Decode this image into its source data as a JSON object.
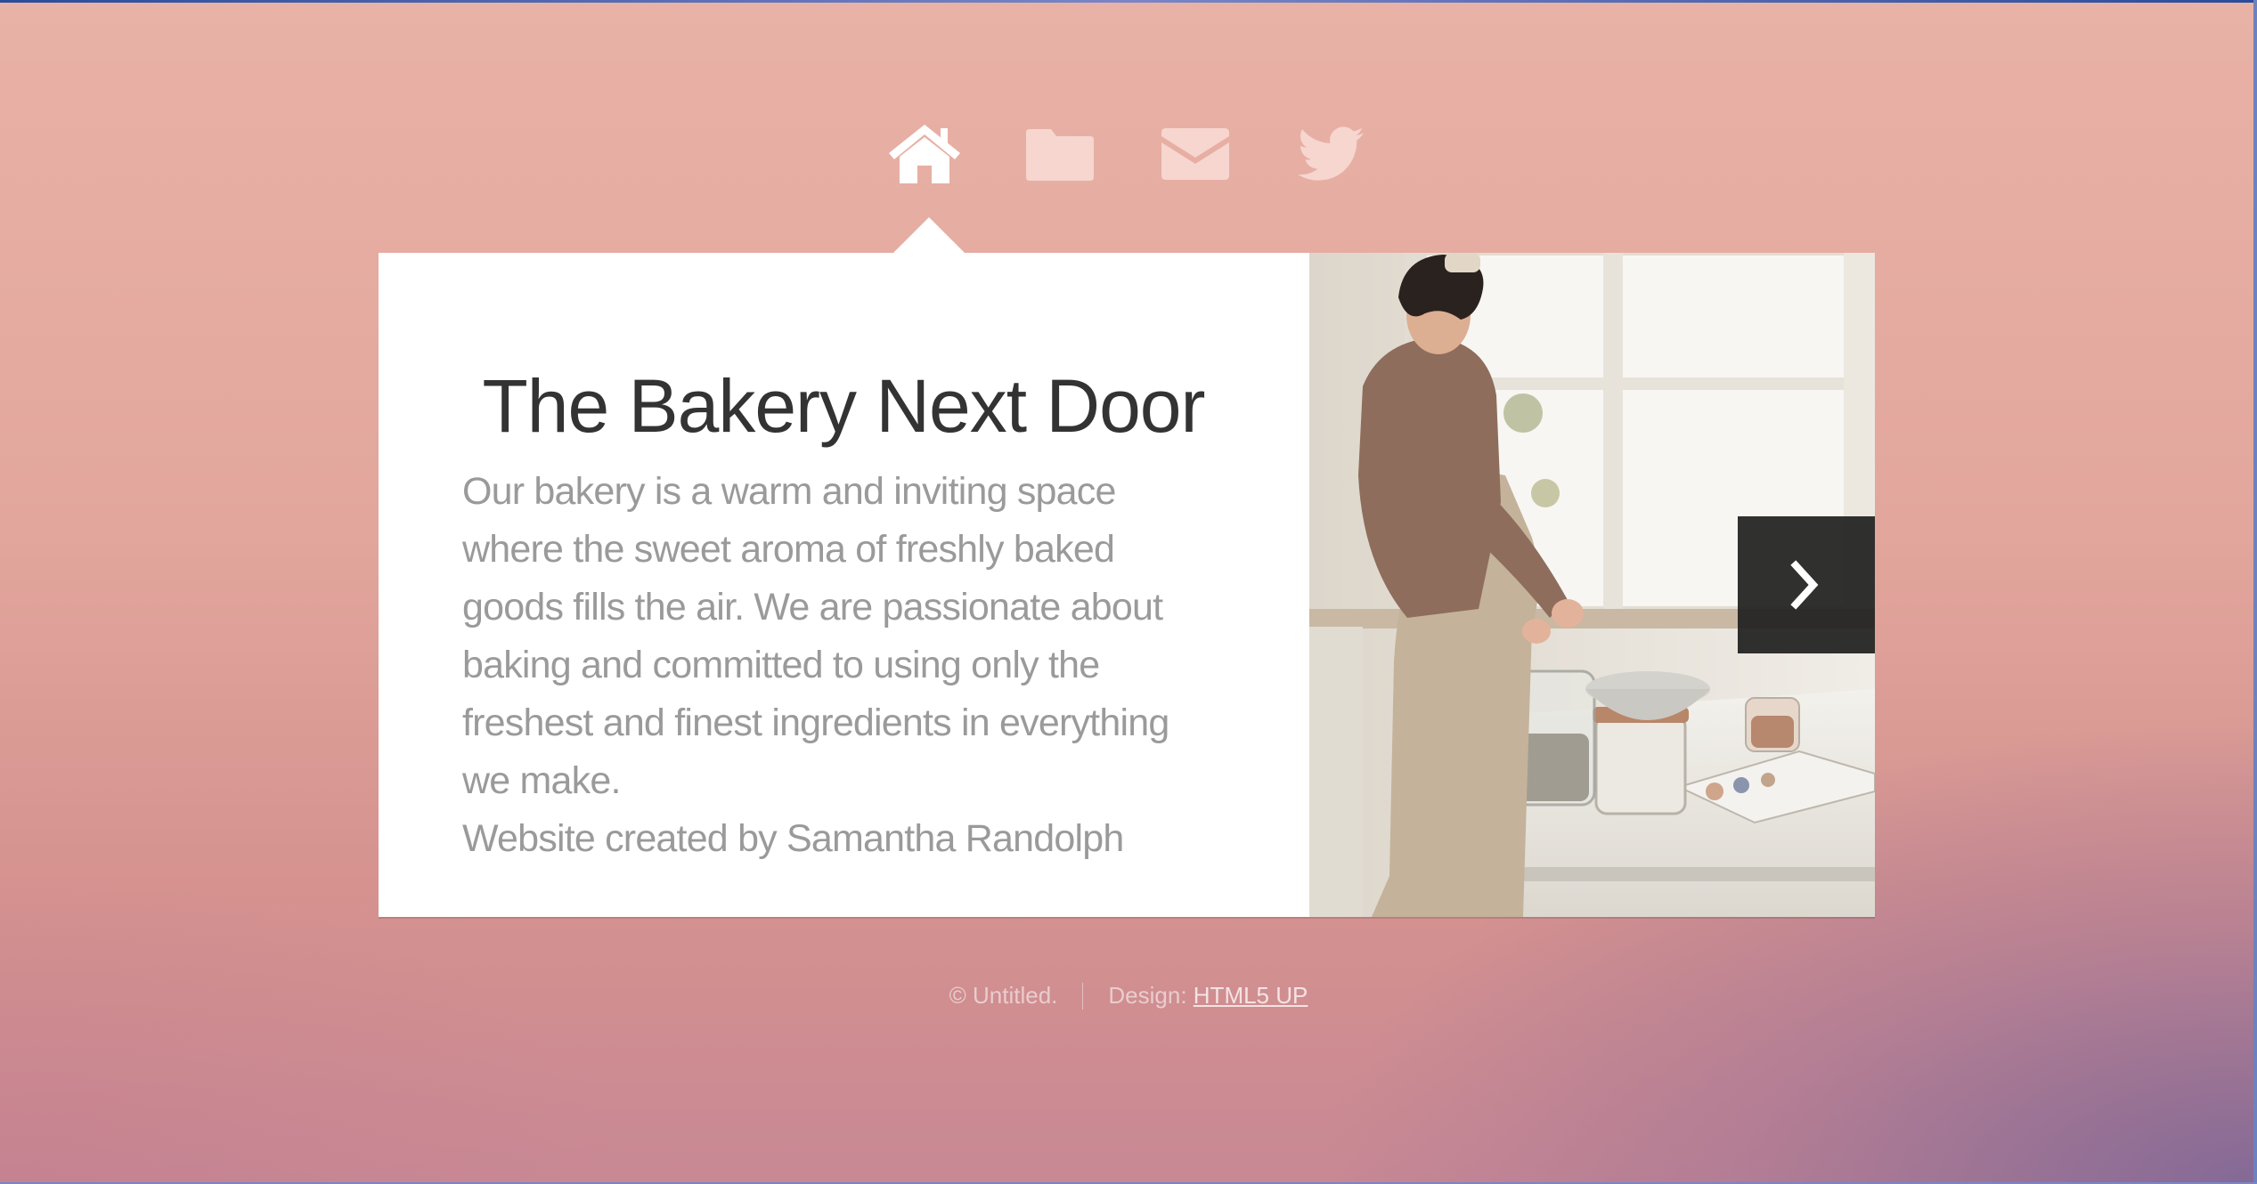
{
  "nav": {
    "items": [
      {
        "icon": "home-icon",
        "active": true
      },
      {
        "icon": "folder-icon",
        "active": false
      },
      {
        "icon": "envelope-icon",
        "active": false
      },
      {
        "icon": "twitter-icon",
        "active": false
      }
    ]
  },
  "main": {
    "title": "The Bakery Next Door",
    "description": "Our bakery is a warm and inviting space where the sweet aroma of freshly baked goods fills the air. We are passionate about baking and committed to using only the freshest and finest ingredients in everything we make.",
    "credit": "Website created by Samantha Randolph",
    "next_icon": "chevron-right-icon"
  },
  "footer": {
    "copyright": "© Untitled.",
    "design_label": "Design:",
    "design_link": "HTML5 UP"
  },
  "colors": {
    "background_top": "#e9b2a6",
    "background_bottom_right": "#9c7c9a",
    "panel": "#ffffff",
    "title": "#333333",
    "body_text": "#9a9a9a",
    "icon_inactive": "#f6d6cf"
  }
}
